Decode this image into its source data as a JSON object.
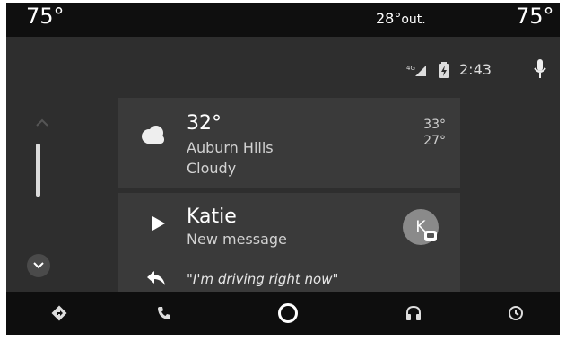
{
  "climate": {
    "driver_temp": "75°",
    "outside_temp": "28°",
    "outside_unit": "out.",
    "passenger_temp": "75°"
  },
  "status_bar": {
    "network": "4G",
    "time": "2:43"
  },
  "weather_card": {
    "temperature": "32°",
    "location": "Auburn Hills",
    "condition": "Cloudy",
    "high": "33°",
    "low": "27°",
    "icon": "cloud-icon"
  },
  "message_card": {
    "sender": "Katie",
    "subtitle": "New message",
    "avatar_letter": "K",
    "reply_text": "\"I'm driving right now\""
  },
  "nav": {
    "items": [
      "navigation-icon",
      "phone-icon",
      "home-icon",
      "audio-icon",
      "exit-icon"
    ]
  },
  "colors": {
    "background": "#2e2e2e",
    "card": "#3a3a3a",
    "bars": "#0f0f0f",
    "text": "#ffffff"
  }
}
